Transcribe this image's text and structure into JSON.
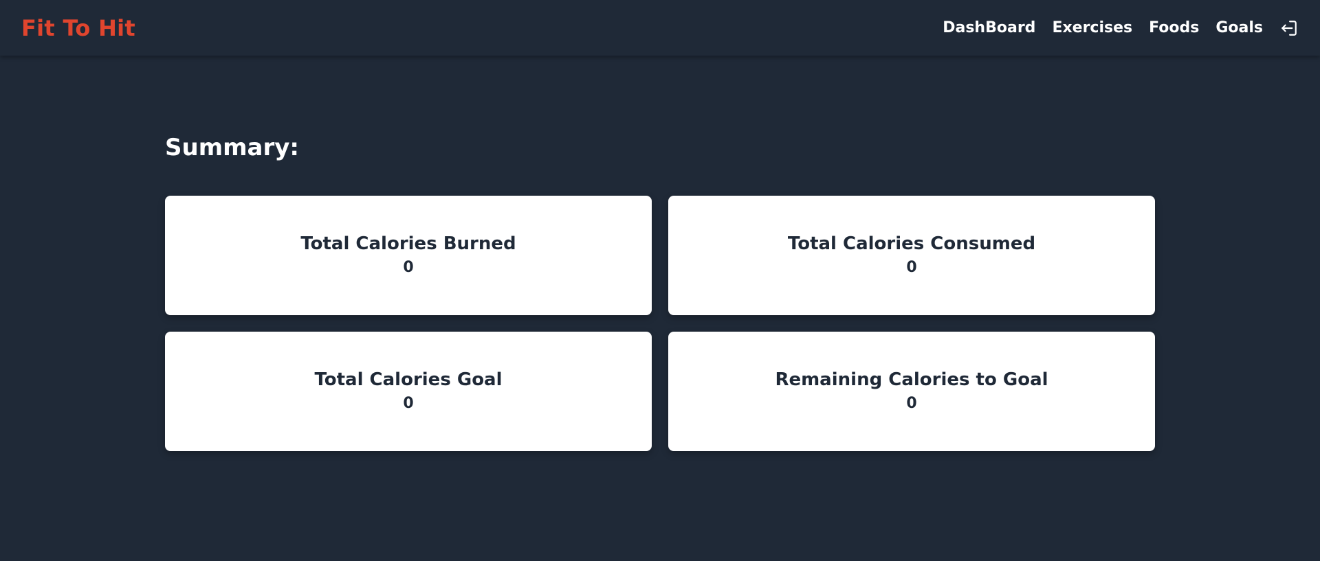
{
  "app": {
    "brand": "Fit To Hit",
    "brand_color": "#e0452e",
    "background_color": "#1f2937"
  },
  "nav": {
    "items": [
      {
        "label": "DashBoard"
      },
      {
        "label": "Exercises"
      },
      {
        "label": "Foods"
      },
      {
        "label": "Goals"
      }
    ],
    "logout_icon": "logout-icon"
  },
  "main": {
    "title": "Summary:",
    "cards": [
      {
        "title": "Total Calories Burned",
        "value": "0"
      },
      {
        "title": "Total Calories Consumed",
        "value": "0"
      },
      {
        "title": "Total Calories Goal",
        "value": "0"
      },
      {
        "title": "Remaining Calories to Goal",
        "value": "0"
      }
    ]
  }
}
